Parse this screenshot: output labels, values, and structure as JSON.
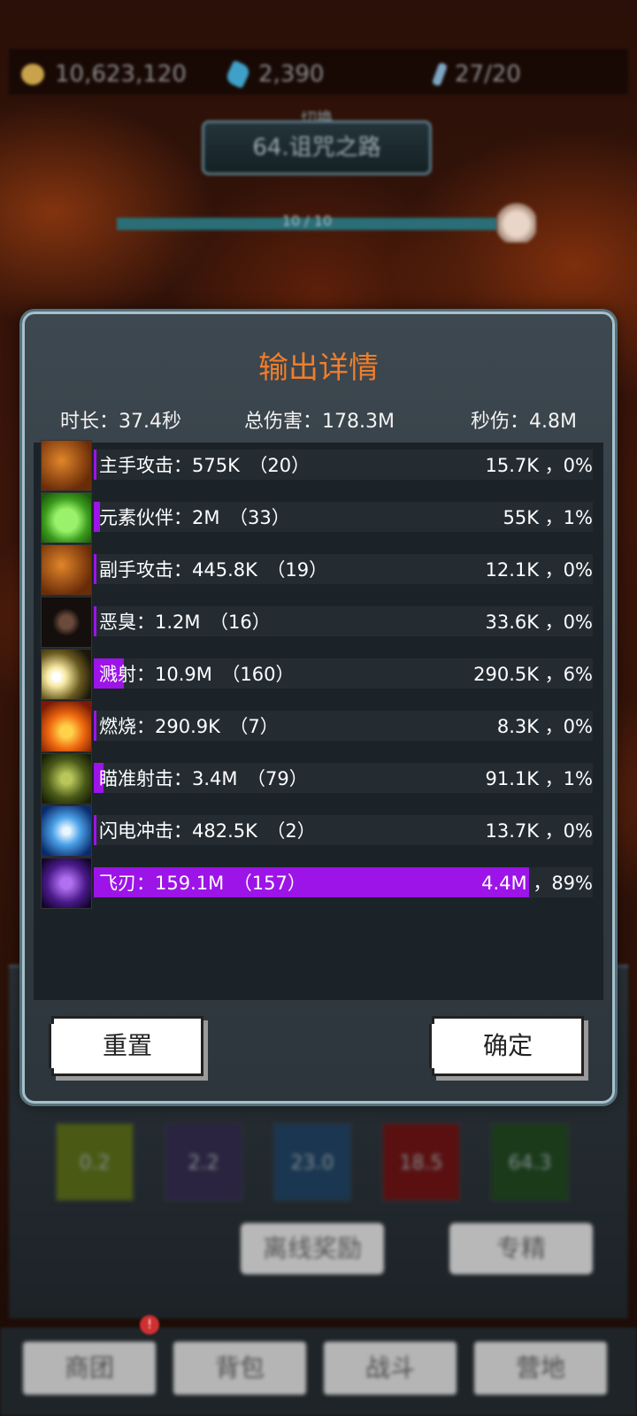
{
  "hud": {
    "gold": "10,623,120",
    "gems": "2,390",
    "keys": "27/20"
  },
  "stage": {
    "switch_label": "切换",
    "name": "64.诅咒之路",
    "progress_text": "10 / 10"
  },
  "modal": {
    "title": "输出详情",
    "duration_label": "时长：",
    "duration_value": "37.4秒",
    "total_label": "总伤害：",
    "total_value": "178.3M",
    "dps_label": "秒伤：",
    "dps_value": "4.8M",
    "rows": [
      {
        "name": "主手攻击：575K　（20）",
        "dps": "15.7K ，0%",
        "fill": 0.004,
        "icon": "sword-orange-icon"
      },
      {
        "name": "元素伙伴：2M　（33）",
        "dps": "55K ，1%",
        "fill": 0.012,
        "icon": "paw-green-icon"
      },
      {
        "name": "副手攻击：445.8K　（19）",
        "dps": "12.1K ，0%",
        "fill": 0.004,
        "icon": "sword-orange-icon"
      },
      {
        "name": "恶臭：1.2M　（16）",
        "dps": "33.6K ，0%",
        "fill": 0.004,
        "icon": "stench-icon"
      },
      {
        "name": "溅射：10.9M　（160）",
        "dps": "290.5K ，6%",
        "fill": 0.06,
        "icon": "splash-burst-icon"
      },
      {
        "name": "燃烧：290.9K　（7）",
        "dps": "8.3K ，0%",
        "fill": 0.0,
        "icon": "fire-icon"
      },
      {
        "name": "瞄准射击：3.4M　（79）",
        "dps": "91.1K ，1%",
        "fill": 0.019,
        "icon": "bow-icon"
      },
      {
        "name": "闪电冲击：482.5K　（2）",
        "dps": "13.7K ，0%",
        "fill": 0.0,
        "icon": "lightning-icon"
      },
      {
        "name": "飞刃：159.1M　（157）",
        "dps": "4.4M ，89%",
        "fill": 0.873,
        "icon": "flying-blade-icon"
      }
    ],
    "reset_label": "重置",
    "confirm_label": "确定"
  },
  "background": {
    "skill_values": [
      "0.2",
      "2.2",
      "23.0",
      "18.5",
      "64.3"
    ],
    "offline_reward_label": "离线奖励",
    "mastery_label": "专精",
    "tabs": [
      "商团",
      "背包",
      "战斗",
      "营地"
    ],
    "tab_badge": "!"
  },
  "colors": {
    "accent_title": "#f07d2a",
    "bar_fill": "#9d14e8"
  }
}
